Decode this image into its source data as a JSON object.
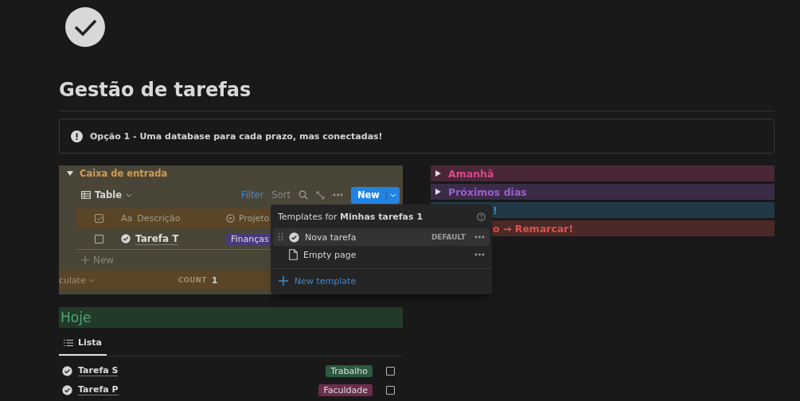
{
  "title": "Gestão de tarefas",
  "callout": "Opção 1 - Uma database para cada prazo, mas conectadas!",
  "inbox": {
    "title": "Caixa de entrada",
    "expanded": true,
    "view": "Table",
    "toolbar": {
      "filter": "Filter",
      "sort": "Sort",
      "new": "New"
    },
    "columns": [
      {
        "kind": "title",
        "icon_text": "Aa",
        "label": "Descrição"
      },
      {
        "kind": "select",
        "label": "Projeto"
      }
    ],
    "rows": [
      {
        "checked": false,
        "title": "Tarefa T",
        "tag": {
          "label": "Finanças",
          "color": "#4a3a7c"
        }
      }
    ],
    "add_row": "New",
    "footer": {
      "calculate": "culate",
      "count_label": "COUNT",
      "count": "1"
    }
  },
  "toggles": [
    {
      "label": "Amanhã",
      "color": "#d8488c",
      "covered": false
    },
    {
      "label": "Próximos dias",
      "color": "#9a5fd0",
      "covered": false
    },
    {
      "label": "!",
      "color": "#3a8fd0",
      "covered": true
    },
    {
      "label": "o → Remarcar!",
      "color": "#e0524a",
      "covered": true
    }
  ],
  "today": {
    "heading": "Hoje",
    "tabs": [
      {
        "label": "Lista",
        "selected": true
      }
    ],
    "items": [
      {
        "title": "Tarefa S",
        "tag": {
          "label": "Trabalho",
          "color": "#2b5a3f"
        },
        "checked": false
      },
      {
        "title": "Tarefa P",
        "tag": {
          "label": "Faculdade",
          "color": "#6b2d4c"
        },
        "checked": false
      }
    ]
  },
  "templates": {
    "title": "Templates for **Minhas tarefas 1**",
    "items": [
      {
        "kind": "task",
        "label": "Nova tarefa",
        "badge": "DEFAULT",
        "selected": true
      },
      {
        "kind": "page",
        "label": "Empty page",
        "selected": false
      }
    ],
    "add": "New template"
  }
}
